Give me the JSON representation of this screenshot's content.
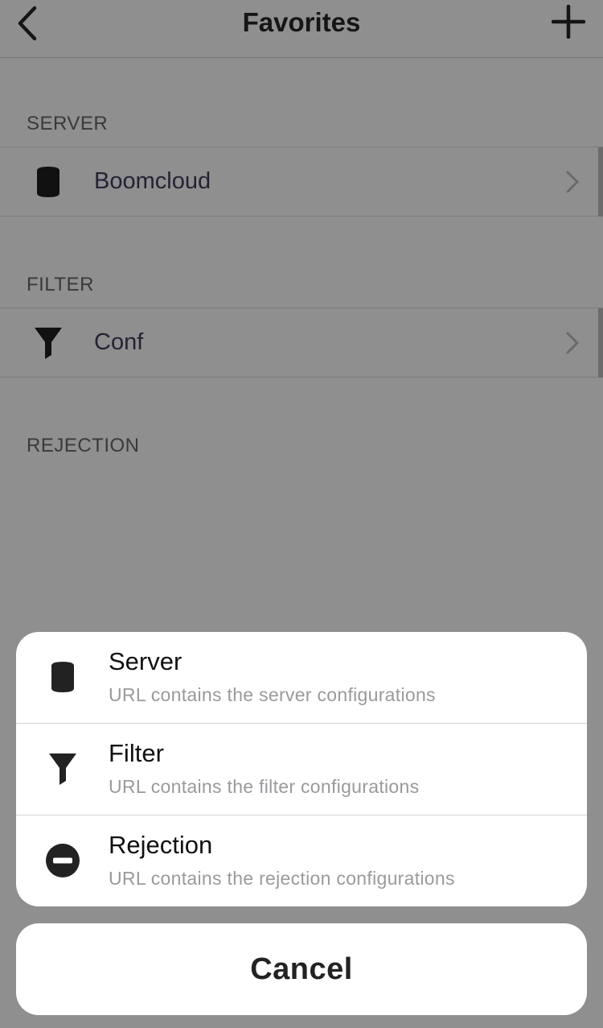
{
  "navbar": {
    "title": "Favorites",
    "back_icon": "chevron-left-icon",
    "add_icon": "plus-icon"
  },
  "sections": [
    {
      "header": "SERVER",
      "item": {
        "label": "Boomcloud",
        "icon": "database-icon"
      }
    },
    {
      "header": "FILTER",
      "item": {
        "label": "Conf",
        "icon": "funnel-icon"
      }
    },
    {
      "header": "REJECTION"
    }
  ],
  "action_sheet": {
    "options": [
      {
        "title": "Server",
        "subtitle": "URL contains the server configurations",
        "icon": "database-icon"
      },
      {
        "title": "Filter",
        "subtitle": "URL contains the filter configurations",
        "icon": "funnel-icon"
      },
      {
        "title": "Rejection",
        "subtitle": "URL contains the rejection configurations",
        "icon": "minus-circle-icon"
      }
    ],
    "cancel_label": "Cancel"
  },
  "colors": {
    "dimmed_background": "#8f8f8f",
    "sheet_background": "#ffffff",
    "subtitle_text": "#9a9a9e"
  }
}
